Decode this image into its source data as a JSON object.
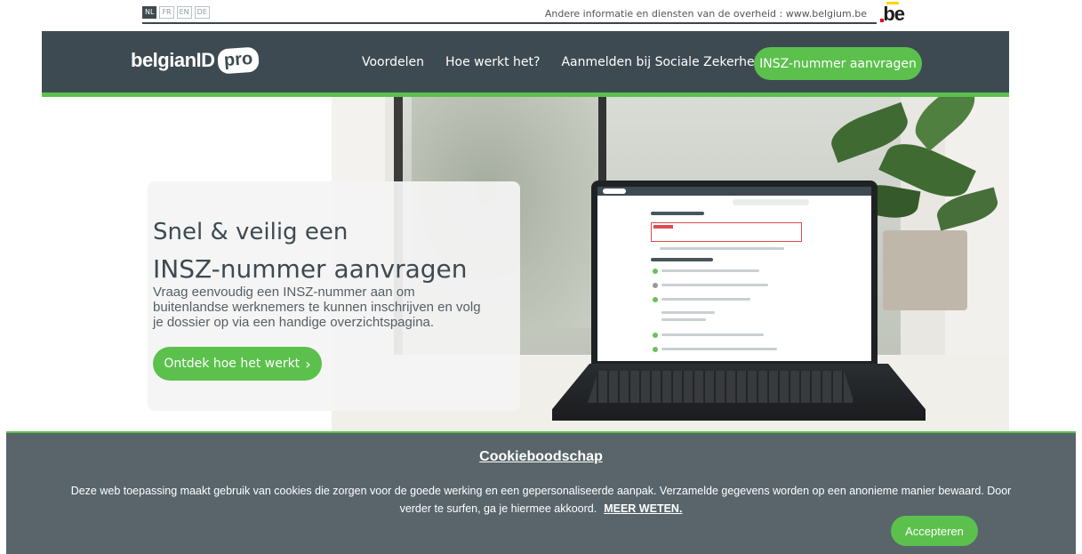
{
  "top_bar": {
    "languages": [
      {
        "code": "NL",
        "active": true
      },
      {
        "code": "FR",
        "active": false
      },
      {
        "code": "EN",
        "active": false
      },
      {
        "code": "DE",
        "active": false
      }
    ],
    "gov_text": "Andere informatie en diensten van de overheid : www.belgium.be",
    "be_logo": "be"
  },
  "header": {
    "brand": "belgianID",
    "brand_badge": "pro",
    "nav": [
      "Voordelen",
      "Hoe werkt het?",
      "Aanmelden bij Sociale Zekerheid"
    ],
    "cta": "INSZ-nummer aanvragen"
  },
  "hero": {
    "title_line1": "Snel & veilig een",
    "title_line2": "INSZ-nummer aanvragen",
    "description": "Vraag eenvoudig een INSZ-nummer aan om buitenlandse werknemers te kunnen inschrijven en volg je dossier op via een handige overzichtspagina.",
    "cta": "Ontdek hoe het werkt",
    "cta_icon": "chevron-right-icon"
  },
  "cookie": {
    "title": "Cookieboodschap",
    "text": "Deze web toepassing maakt gebruik van cookies die zorgen voor de goede werking en een gepersonaliseerde aanpak. Verzamelde gegevens worden op een anonieme manier bewaard. Door verder te surfen, ga je hiermee akkoord.",
    "link": "MEER WETEN.",
    "accept": "Accepteren"
  },
  "colors": {
    "header_bg": "#3e4a51",
    "accent_green": "#5cc04d",
    "cookie_bg": "#546066"
  }
}
